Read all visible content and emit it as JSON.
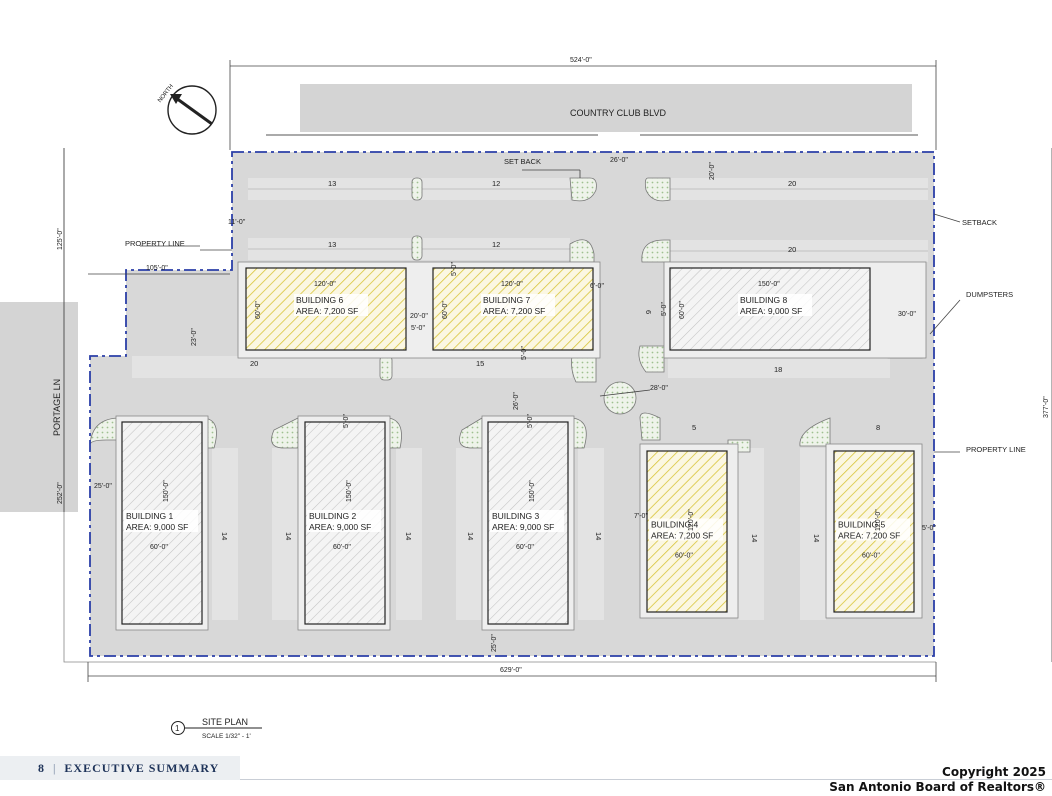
{
  "drawing": {
    "street_top": "COUNTRY CLUB BLVD",
    "street_left": "PORTAGE LN",
    "north_label": "NORTH",
    "dims": {
      "top_width": "524'-0\"",
      "bottom_width": "629'-0\"",
      "left_upper": "125'-0\"",
      "left_lower": "252'-0\"",
      "right_height": "377'-0\"",
      "offset_105": "105'-0\"",
      "drive_26": "26'-0\"",
      "setback_20": "20'-0\"",
      "d_11": "11'-0\"",
      "d_23": "23'-0\"",
      "d_25_left": "25'-0\"",
      "d_25_bottom": "25'-0\"",
      "d_26_mid": "26'-0\"",
      "d_28": "28'-0\"",
      "d_30": "30'-0\"",
      "d_7": "7'-0\"",
      "d_5_b5": "5'-0\"",
      "d_20_gap": "20'-0\"",
      "d_5_gap": "5'-0\"",
      "d_5_a": "5'-0\"",
      "d_5_b": "5'-0\"",
      "d_5_c": "5'-0\"",
      "d_5_d": "5'-0\"",
      "d_6_a": "6'-0\"",
      "d_5_e": "5'-0\""
    },
    "labels": {
      "set_back": "SET BACK",
      "setback": "SETBACK",
      "property_line_left": "PROPERTY LINE",
      "property_line_right": "PROPERTY LINE",
      "dumpsters": "DUMPSTERS"
    },
    "parking_counts": {
      "r1a": "13",
      "r1b": "12",
      "r1c": "20",
      "r2a": "13",
      "r2b": "12",
      "r2c": "20",
      "r3a": "20",
      "r3b": "15",
      "r3c": "18",
      "col1": "14",
      "col2": "14",
      "col3": "14",
      "col4": "14",
      "col5": "14",
      "col6": "14",
      "col7": "14",
      "top4": "5",
      "top5": "8",
      "side6": "6"
    },
    "buildings": [
      {
        "name": "BUILDING 1",
        "area": "AREA: 9,000 SF",
        "w": "60'-0\"",
        "h": "150'-0\""
      },
      {
        "name": "BUILDING 2",
        "area": "AREA: 9,000 SF",
        "w": "60'-0\"",
        "h": "150'-0\""
      },
      {
        "name": "BUILDING 3",
        "area": "AREA: 9,000 SF",
        "w": "60'-0\"",
        "h": "150'-0\""
      },
      {
        "name": "BUILDING 4",
        "area": "AREA: 7,200 SF",
        "w": "60'-0\"",
        "h": "120'-0\""
      },
      {
        "name": "BUILDING 5",
        "area": "AREA: 7,200 SF",
        "w": "60'-0\"",
        "h": "120'-0\""
      },
      {
        "name": "BUILDING 6",
        "area": "AREA: 7,200 SF",
        "w": "120'-0\"",
        "h": "60'-0\""
      },
      {
        "name": "BUILDING 7",
        "area": "AREA: 7,200 SF",
        "w": "120'-0\"",
        "h": "60'-0\""
      },
      {
        "name": "BUILDING 8",
        "area": "AREA: 9,000 SF",
        "w": "150'-0\"",
        "h": "60'-0\""
      }
    ],
    "title_block": {
      "number": "1",
      "title": "SITE PLAN",
      "scale": "SCALE 1/32\" - 1'"
    }
  },
  "footer": {
    "page": "8",
    "separator": "|",
    "section": "EXECUTIVE SUMMARY"
  },
  "copyright": {
    "line1": "Copyright 2025",
    "line2": "San Antonio Board of Realtors®"
  },
  "colors": {
    "boundary": "#2b3fa8",
    "road": "#d4d4d4",
    "parking": "#dcdcdc",
    "hatch_yellow": "#d9c53a",
    "hatch_gray": "#bdbdbd",
    "landscape": "#a8c99a"
  }
}
